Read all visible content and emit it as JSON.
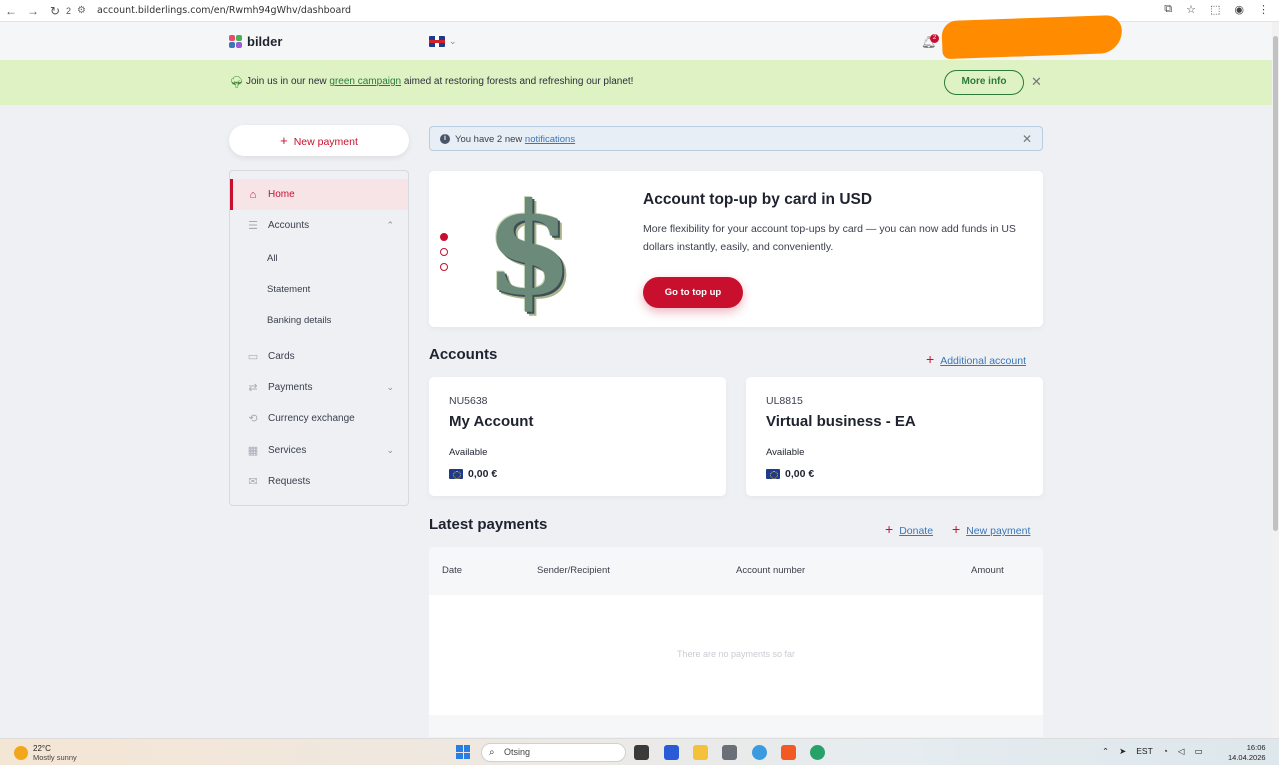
{
  "browser": {
    "tab_count": "2",
    "url": "account.bilderlings.com/en/Rwmh94gWhv/dashboard"
  },
  "header": {
    "brand": "bilder",
    "notification_count": "2"
  },
  "campaign": {
    "text_before": "Join us in our new ",
    "link_text": "green campaign",
    "text_after": " aimed at restoring forests and refreshing our planet!",
    "button": "More info"
  },
  "sidebar": {
    "new_payment": "New payment",
    "items": {
      "home": "Home",
      "accounts": "Accounts",
      "all": "All",
      "statement": "Statement",
      "banking_details": "Banking details",
      "cards": "Cards",
      "payments": "Payments",
      "currency_exchange": "Currency exchange",
      "services": "Services",
      "requests": "Requests"
    }
  },
  "notification": {
    "text": "You have 2 new ",
    "link": "notifications"
  },
  "promo": {
    "title": "Account top-up by card in USD",
    "body": "More flexibility for your account top-ups by card — you can now add funds in US dollars instantly, easily, and conveniently.",
    "button": "Go to top up",
    "slide_count": 3,
    "active_slide": 1
  },
  "accounts": {
    "title": "Accounts",
    "add_link": "Additional account",
    "cards": [
      {
        "number": "NU5638",
        "name": "My Account",
        "available_label": "Available",
        "balance": "0,00 €"
      },
      {
        "number": "UL8815",
        "name": "Virtual business - EA",
        "available_label": "Available",
        "balance": "0,00 €"
      }
    ]
  },
  "payments": {
    "title": "Latest payments",
    "donate": "Donate",
    "new_payment": "New payment",
    "columns": {
      "date": "Date",
      "party": "Sender/Recipient",
      "account": "Account number",
      "amount": "Amount"
    },
    "empty": "There are no payments so far"
  },
  "taskbar": {
    "temp": "22°C",
    "weather": "Mostly sunny",
    "search_placeholder": "Otsing",
    "lang": "EST",
    "time": "16:06",
    "date": "14.04.2026"
  },
  "colors": {
    "brand_red": "#c8102e",
    "campaign_bg": "#dff2c4",
    "campaign_green": "#2c7a3a",
    "link_blue": "#3a76b8"
  }
}
